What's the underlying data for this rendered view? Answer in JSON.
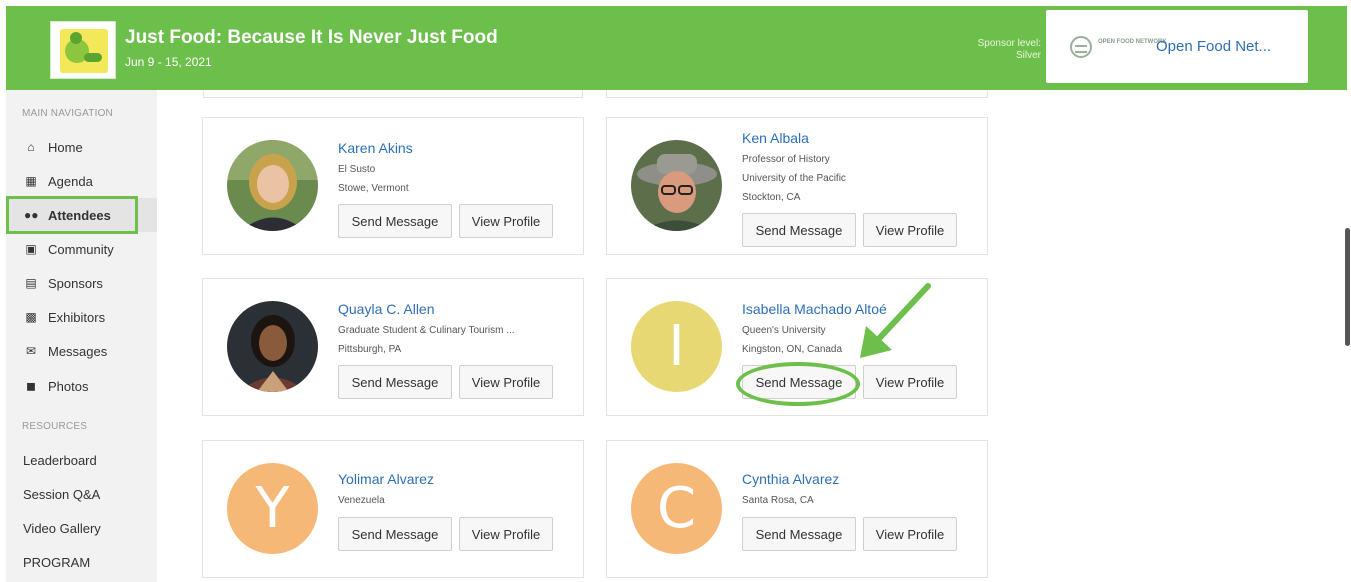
{
  "header": {
    "event_title": "Just Food: Because It Is Never Just Food",
    "event_dates": "Jun 9 - 15, 2021",
    "sponsor_level_label": "Sponsor level:",
    "sponsor_level_value": "Silver",
    "sponsor_logo_text": "OPEN FOOD NETWORK",
    "sponsor_name": "Open Food Net...",
    "brand_color": "#6cbf4a"
  },
  "sidebar": {
    "main_nav_label": "MAIN NAVIGATION",
    "items": [
      {
        "label": "Home",
        "icon": "home-icon"
      },
      {
        "label": "Agenda",
        "icon": "calendar-icon"
      },
      {
        "label": "Attendees",
        "icon": "users-icon",
        "active": true
      },
      {
        "label": "Community",
        "icon": "comments-icon"
      },
      {
        "label": "Sponsors",
        "icon": "building-icon"
      },
      {
        "label": "Exhibitors",
        "icon": "booth-icon"
      },
      {
        "label": "Messages",
        "icon": "envelope-icon"
      },
      {
        "label": "Photos",
        "icon": "camera-icon"
      }
    ],
    "resources_label": "RESOURCES",
    "resources": [
      "Leaderboard",
      "Session Q&A",
      "Video Gallery",
      "PROGRAM"
    ]
  },
  "buttons": {
    "send": "Send Message",
    "view": "View Profile"
  },
  "attendees": [
    {
      "name": "Karen Akins",
      "lines": [
        "El Susto",
        "Stowe, Vermont"
      ],
      "avatar": "photo"
    },
    {
      "name": "Ken Albala",
      "lines": [
        "Professor of History",
        "University of the Pacific",
        "Stockton, CA"
      ],
      "avatar": "photo"
    },
    {
      "name": "Quayla C. Allen",
      "lines": [
        "Graduate Student & Culinary Tourism ...",
        "Pittsburgh, PA"
      ],
      "avatar": "photo"
    },
    {
      "name": "Isabella Machado Altoé",
      "lines": [
        "Queen's University",
        "Kingston, ON, Canada"
      ],
      "avatar_letter": "I",
      "avatar_color": "#e8d874"
    },
    {
      "name": "Yolimar Alvarez",
      "lines": [
        "Venezuela"
      ],
      "avatar_letter": "Y",
      "avatar_color": "#f5b877"
    },
    {
      "name": "Cynthia Alvarez",
      "lines": [
        "Santa Rosa, CA"
      ],
      "avatar_letter": "C",
      "avatar_color": "#f5b877"
    }
  ],
  "annotation_color": "#6cbf4a"
}
